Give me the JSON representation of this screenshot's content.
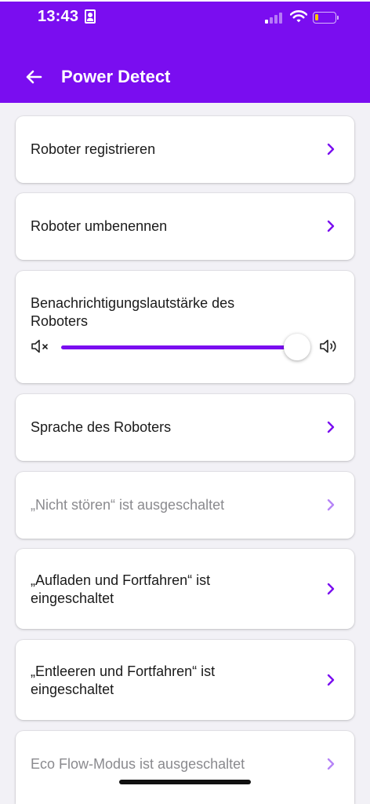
{
  "status_bar": {
    "time": "13:43"
  },
  "header": {
    "title": "Power Detect"
  },
  "items": [
    {
      "label": "Roboter registrieren",
      "enabled": true
    },
    {
      "label": "Roboter umbenennen",
      "enabled": true
    },
    {
      "label": "Benachrichtigungslautstärke des Roboters",
      "slider_value": 0.95
    },
    {
      "label": "Sprache des Roboters",
      "enabled": true
    },
    {
      "label": "„Nicht stören“ ist ausgeschaltet",
      "enabled": false
    },
    {
      "label": "„Aufladen und Fortfahren“ ist eingeschaltet",
      "enabled": true
    },
    {
      "label": "„Entleeren und Fortfahren“ ist eingeschaltet",
      "enabled": true
    },
    {
      "label": "Eco Flow-Modus ist ausgeschaltet",
      "enabled": false
    }
  ],
  "colors": {
    "accent": "#7a0df0",
    "background": "#f2f1f6",
    "card": "#ffffff",
    "disabled_text": "#8a8a8e"
  },
  "icons": [
    "back-arrow-icon",
    "chevron-right-icon",
    "volume-mute-icon",
    "volume-up-icon",
    "battery-icon",
    "wifi-icon",
    "signal-icon"
  ]
}
